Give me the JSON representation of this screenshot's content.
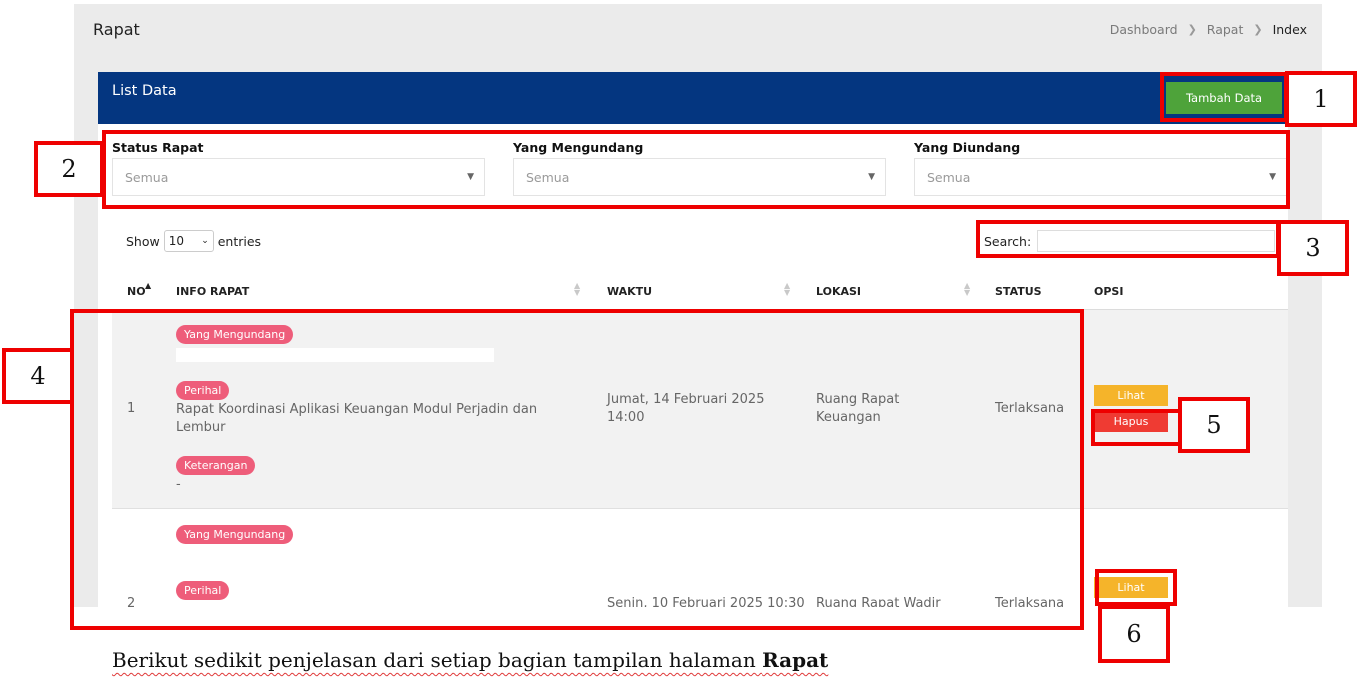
{
  "page": {
    "title": "Rapat",
    "breadcrumb": [
      "Dashboard",
      "Rapat",
      "Index"
    ]
  },
  "card": {
    "title": "List Data",
    "add_button": "Tambah Data"
  },
  "filters": [
    {
      "label": "Status Rapat",
      "value": "Semua"
    },
    {
      "label": "Yang Mengundang",
      "value": "Semua"
    },
    {
      "label": "Yang Diundang",
      "value": "Semua"
    }
  ],
  "table_controls": {
    "show_label": "Show",
    "entries_value": "10",
    "entries_label": "entries",
    "search_label": "Search:",
    "search_value": ""
  },
  "table": {
    "columns": [
      "NO",
      "INFO RAPAT",
      "WAKTU",
      "LOKASI",
      "STATUS",
      "OPSI"
    ],
    "sorted_column": "NO",
    "rows": [
      {
        "no": "1",
        "badge_inviter": "Yang Mengundang",
        "inviter": "",
        "badge_subject": "Perihal",
        "subject": "Rapat Koordinasi Aplikasi Keuangan Modul Perjadin dan Lembur",
        "badge_note": "Keterangan",
        "note": "-",
        "time": "Jumat, 14 Februari 2025 14:00",
        "location": "Ruang Rapat Keuangan",
        "status": "Terlaksana",
        "actions": [
          "Lihat",
          "Hapus"
        ]
      },
      {
        "no": "2",
        "badge_inviter": "Yang Mengundang",
        "inviter": "",
        "badge_subject": "Perihal",
        "subject": "",
        "time": "Senin, 10 Februari 2025 10:30",
        "location": "Ruang Rapat Wadir",
        "status": "Terlaksana",
        "actions": [
          "Lihat"
        ]
      }
    ]
  },
  "callouts": [
    "1",
    "2",
    "3",
    "4",
    "5",
    "6"
  ],
  "caption": {
    "text": "Berikut sedikit penjelasan dari setiap bagian tampilan halaman ",
    "bold": "Rapat"
  },
  "colors": {
    "header": "#043680",
    "add_button": "#4ea33a",
    "badge": "#ee5d7a",
    "lihat": "#f5b42a",
    "hapus": "#ef3b33",
    "annotation": "#ee0000"
  }
}
